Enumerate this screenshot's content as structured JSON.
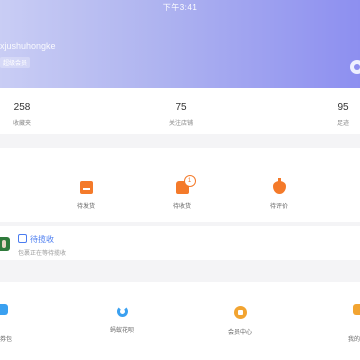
{
  "status_bar": {
    "time": "下午3:41"
  },
  "profile": {
    "username": "xjushuhongke",
    "member_label": "超级会员"
  },
  "stats": [
    {
      "value": "258",
      "label": "收藏夹"
    },
    {
      "value": "75",
      "label": "关注店铺"
    },
    {
      "value": "95",
      "label": "足迹"
    }
  ],
  "orders": [
    {
      "label": "待发货",
      "icon": "wallet-icon"
    },
    {
      "label": "待收货",
      "icon": "truck-icon",
      "badge": "1"
    },
    {
      "label": "待评价",
      "icon": "review-icon"
    }
  ],
  "tracking": {
    "title": "待揽收",
    "desc": "包裹正在等待揽收"
  },
  "services": [
    {
      "label": "券包",
      "icon": "coupon-icon"
    },
    {
      "label": "蚂蚁花呗",
      "icon": "huabei-icon"
    },
    {
      "label": "会员中心",
      "icon": "member-center-icon"
    },
    {
      "label": "我的",
      "icon": "my-icon"
    }
  ],
  "colors": {
    "accent_orange": "#f47a2a",
    "accent_blue": "#4a7cf0",
    "header_start": "#c9cdf4",
    "header_end": "#8d8ff0"
  }
}
